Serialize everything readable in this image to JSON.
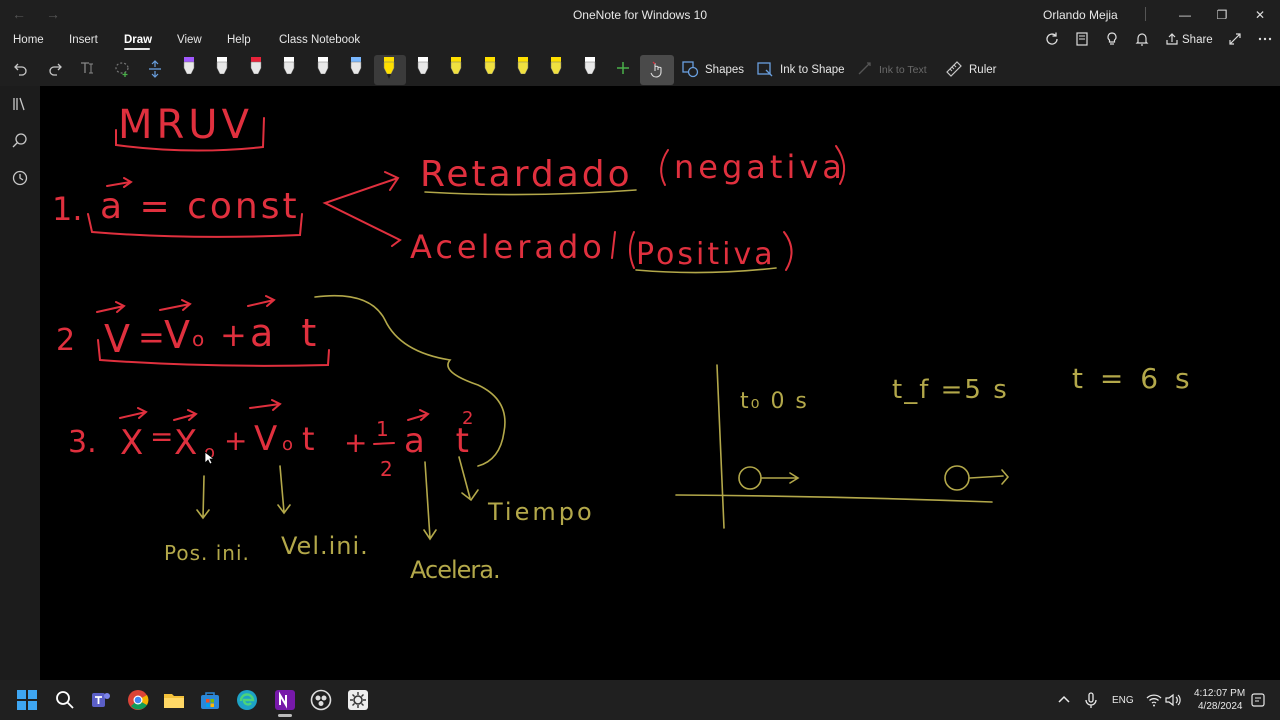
{
  "window": {
    "title": "OneNote for Windows 10",
    "user": "Orlando Mejia",
    "back_glyph": "←",
    "forward_glyph": "→",
    "minimize_glyph": "—",
    "maximize_glyph": "❐",
    "close_glyph": "✕"
  },
  "menu": {
    "tabs": [
      "Home",
      "Insert",
      "Draw",
      "View",
      "Help",
      "Class Notebook"
    ],
    "active": "Draw",
    "share_label": "Share"
  },
  "toolbar": {
    "shapes_label": "Shapes",
    "ink_to_shape_label": "Ink to Shape",
    "ink_to_text_label": "Ink to Text",
    "ruler_label": "Ruler",
    "pen_colors": [
      "#e8e8e8",
      "#e8e8e8",
      "#e8e8e8",
      "#e8e8e8",
      "#e8e8e8",
      "#e8e8e8",
      "#ffe000",
      "#e8e8e8",
      "#f0e040",
      "#f0e040",
      "#f0e040",
      "#f0e040",
      "#e8e8e8"
    ],
    "pen_tip_colors": [
      "#a259ff",
      "#ffffff",
      "#e8233a",
      "#ffffff",
      "#ffffff",
      "#7ab8ff",
      "#ffe000",
      "#ffffff",
      "#ffe000",
      "#ffe000",
      "#ffe000",
      "#ffe000",
      "#ffffff"
    ]
  },
  "notes": {
    "heading": "MRUV",
    "eq1_number": "1.",
    "eq1": "a = const",
    "branch_top": "Retardado",
    "branch_top_sign": "negativa",
    "branch_bottom": "Acelerado",
    "branch_bottom_sign": "Positiva",
    "eq2_number": "2",
    "eq2_lhs": "V",
    "eq2_rhs_v0": "V",
    "eq2_rhs_at": "a t",
    "eq3_number": "3.",
    "eq3_x": "X",
    "eq3_x0": "X",
    "eq3_v0t": "V",
    "eq3_half": "1/2",
    "eq3_at2": "a t",
    "label_pos": "Pos. ini.",
    "label_vel": "Vel.ini.",
    "label_acel": "Acelera.",
    "label_time": "Tiempo",
    "t0_label": "t₀ 0 s",
    "tf_label": "t_f =5 s",
    "t6_label": "t = 6 s"
  },
  "colors": {
    "ink_red": "#e0303e",
    "ink_yellow": "#b3a84a",
    "canvas": "#000000",
    "chrome": "#1f1f1f"
  },
  "taskbar": {
    "language": "ENG",
    "time": "4:12:07 PM",
    "date": "4/28/2024"
  }
}
